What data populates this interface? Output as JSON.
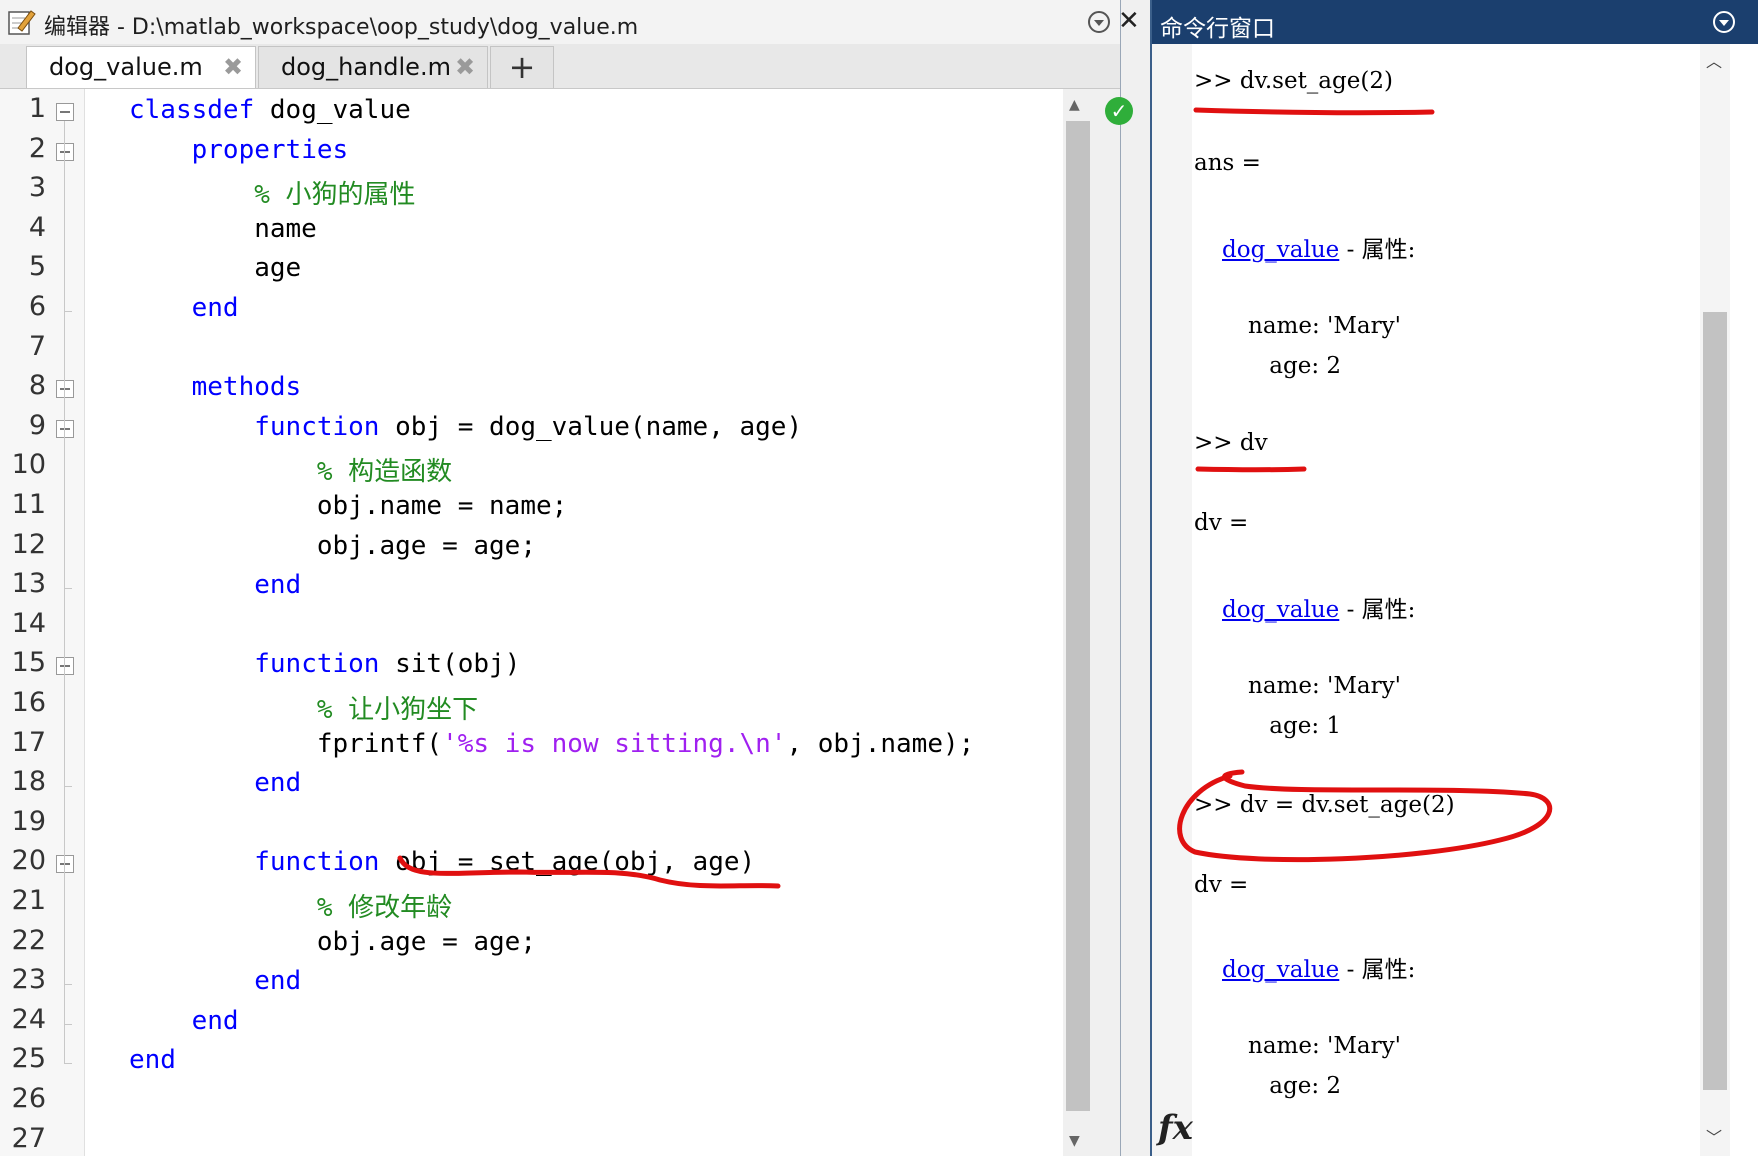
{
  "editor": {
    "title": "编辑器 - D:\\matlab_workspace\\oop_study\\dog_value.m",
    "tabs": [
      {
        "label": "dog_value.m",
        "close": "✖"
      },
      {
        "label": "dog_handle.m",
        "close": "✖"
      }
    ],
    "add_tab": "+",
    "close_glyph": "✕",
    "status": "✓",
    "lines": [
      {
        "n": "1",
        "parts": [
          {
            "t": "classdef",
            "c": "kw"
          },
          {
            "t": " dog_value",
            "c": ""
          }
        ]
      },
      {
        "n": "2",
        "parts": [
          {
            "t": "    ",
            "c": ""
          },
          {
            "t": "properties",
            "c": "kw"
          }
        ]
      },
      {
        "n": "3",
        "parts": [
          {
            "t": "        ",
            "c": ""
          },
          {
            "t": "% 小狗的属性",
            "c": "cm"
          }
        ]
      },
      {
        "n": "4",
        "parts": [
          {
            "t": "        name",
            "c": ""
          }
        ]
      },
      {
        "n": "5",
        "parts": [
          {
            "t": "        age",
            "c": ""
          }
        ]
      },
      {
        "n": "6",
        "parts": [
          {
            "t": "    ",
            "c": ""
          },
          {
            "t": "end",
            "c": "kw"
          }
        ]
      },
      {
        "n": "7",
        "parts": []
      },
      {
        "n": "8",
        "parts": [
          {
            "t": "    ",
            "c": ""
          },
          {
            "t": "methods",
            "c": "kw"
          }
        ]
      },
      {
        "n": "9",
        "parts": [
          {
            "t": "        ",
            "c": ""
          },
          {
            "t": "function",
            "c": "kw"
          },
          {
            "t": " obj = dog_value(name, age)",
            "c": ""
          }
        ]
      },
      {
        "n": "10",
        "parts": [
          {
            "t": "            ",
            "c": ""
          },
          {
            "t": "% 构造函数",
            "c": "cm"
          }
        ]
      },
      {
        "n": "11",
        "parts": [
          {
            "t": "            obj.name = name;",
            "c": ""
          }
        ]
      },
      {
        "n": "12",
        "parts": [
          {
            "t": "            obj.age = age;",
            "c": ""
          }
        ]
      },
      {
        "n": "13",
        "parts": [
          {
            "t": "        ",
            "c": ""
          },
          {
            "t": "end",
            "c": "kw"
          }
        ]
      },
      {
        "n": "14",
        "parts": []
      },
      {
        "n": "15",
        "parts": [
          {
            "t": "        ",
            "c": ""
          },
          {
            "t": "function",
            "c": "kw"
          },
          {
            "t": " sit(obj)",
            "c": ""
          }
        ]
      },
      {
        "n": "16",
        "parts": [
          {
            "t": "            ",
            "c": ""
          },
          {
            "t": "% 让小狗坐下",
            "c": "cm"
          }
        ]
      },
      {
        "n": "17",
        "parts": [
          {
            "t": "            fprintf(",
            "c": ""
          },
          {
            "t": "'%s is now sitting.\\n'",
            "c": "st"
          },
          {
            "t": ", obj.name);",
            "c": ""
          }
        ]
      },
      {
        "n": "18",
        "parts": [
          {
            "t": "        ",
            "c": ""
          },
          {
            "t": "end",
            "c": "kw"
          }
        ]
      },
      {
        "n": "19",
        "parts": []
      },
      {
        "n": "20",
        "parts": [
          {
            "t": "        ",
            "c": ""
          },
          {
            "t": "function",
            "c": "kw"
          },
          {
            "t": " obj = set_age(obj, age)",
            "c": ""
          }
        ]
      },
      {
        "n": "21",
        "parts": [
          {
            "t": "            ",
            "c": ""
          },
          {
            "t": "% 修改年龄",
            "c": "cm"
          }
        ]
      },
      {
        "n": "22",
        "parts": [
          {
            "t": "            obj.age = age;",
            "c": ""
          }
        ]
      },
      {
        "n": "23",
        "parts": [
          {
            "t": "        ",
            "c": ""
          },
          {
            "t": "end",
            "c": "kw"
          }
        ]
      },
      {
        "n": "24",
        "parts": [
          {
            "t": "    ",
            "c": ""
          },
          {
            "t": "end",
            "c": "kw"
          }
        ]
      },
      {
        "n": "25",
        "parts": [
          {
            "t": "end",
            "c": "kw"
          }
        ]
      },
      {
        "n": "26",
        "parts": []
      },
      {
        "n": "27",
        "parts": []
      }
    ]
  },
  "command_window": {
    "title": "命令行窗口",
    "fx": "fx",
    "lines": [
      {
        "parts": [
          {
            "t": ">> dv.set_age(2)",
            "c": ""
          }
        ]
      },
      {
        "parts": [
          {
            "t": "ans =",
            "c": ""
          }
        ]
      },
      {
        "parts": [
          {
            "t": "dog_value",
            "c": "link"
          },
          {
            "t": " - 属性:",
            "c": ""
          }
        ]
      },
      {
        "parts": [
          {
            "t": "name: 'Mary'",
            "c": ""
          }
        ]
      },
      {
        "parts": [
          {
            "t": " age: 2",
            "c": ""
          }
        ]
      },
      {
        "parts": [
          {
            "t": ">> dv",
            "c": ""
          }
        ]
      },
      {
        "parts": [
          {
            "t": "dv =",
            "c": ""
          }
        ]
      },
      {
        "parts": [
          {
            "t": "dog_value",
            "c": "link"
          },
          {
            "t": " - 属性:",
            "c": ""
          }
        ]
      },
      {
        "parts": [
          {
            "t": "name: 'Mary'",
            "c": ""
          }
        ]
      },
      {
        "parts": [
          {
            "t": " age: 1",
            "c": ""
          }
        ]
      },
      {
        "parts": [
          {
            "t": ">> dv = dv.set_age(2)",
            "c": ""
          }
        ]
      },
      {
        "parts": [
          {
            "t": "dv =",
            "c": ""
          }
        ]
      },
      {
        "parts": [
          {
            "t": "dog_value",
            "c": "link"
          },
          {
            "t": " - 属性:",
            "c": ""
          }
        ]
      },
      {
        "parts": [
          {
            "t": "name: 'Mary'",
            "c": ""
          }
        ]
      },
      {
        "parts": [
          {
            "t": " age: 2",
            "c": ""
          }
        ]
      }
    ]
  }
}
